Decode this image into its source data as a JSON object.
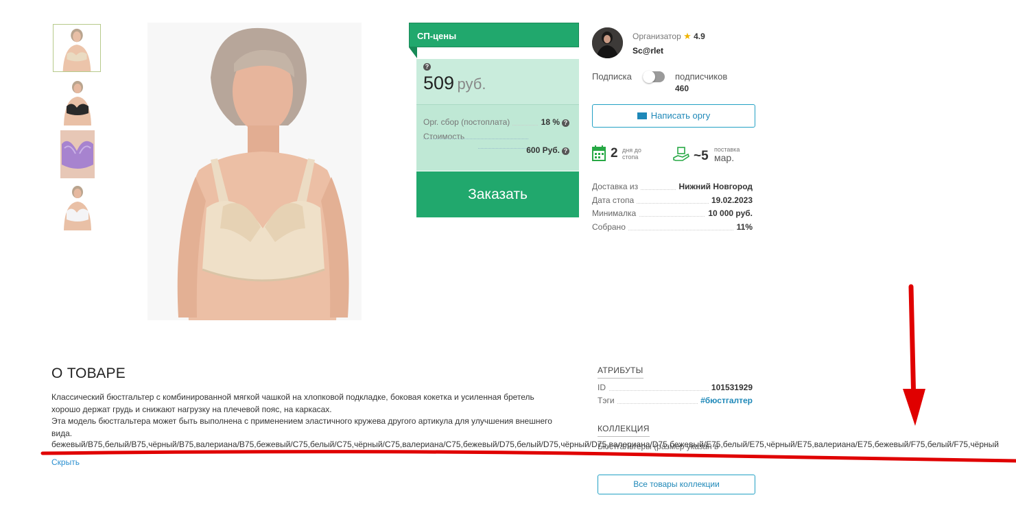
{
  "price_box": {
    "header": "СП-цены",
    "price_value": "509",
    "price_currency": "руб.",
    "fee_label": "Орг. сбор (постоплата)",
    "fee_value": "18 %",
    "cost_label": "Стоимость",
    "cost_value": "600 Руб.",
    "order_button": "Заказать"
  },
  "organizer": {
    "role_label": "Организатор",
    "rating": "4.9",
    "name": "Sc@rlet",
    "subscribe_label": "Подписка",
    "subscribers_label": "подписчиков",
    "subscribers_count": "460",
    "message_button": "Написать оргу"
  },
  "stats": {
    "days_value": "2",
    "days_label_1": "дня до",
    "days_label_2": "стопа",
    "delivery_value": "~5",
    "delivery_label_1": "поставка",
    "delivery_label_2": "мар."
  },
  "details": [
    {
      "label": "Доставка из",
      "value": "Нижний Новгород"
    },
    {
      "label": "Дата стопа",
      "value": "19.02.2023"
    },
    {
      "label": "Минималка",
      "value": "10 000 руб."
    },
    {
      "label": "Собрано",
      "value": "11%"
    }
  ],
  "about": {
    "title": "О ТОВАРЕ",
    "line1": "Классический бюстгальтер  с  комбинированной мягкой чашкой на  хлопковой подкладке, боковая кокетка и усиленная бретель",
    "line2": "хорошо держат грудь  и снижают нагрузку на плечевой пояс, на каркасах.",
    "line3": "Эта модель бюстгальтера может быть выполнена с применением эластичного кружева другого артикула для улучшения внешнего",
    "line4": "вида.",
    "variants": "бежевый/B75,белый/B75,чёрный/B75,валериана/B75,бежевый/C75,белый/C75,чёрный/C75,валериана/C75,бежевый/D75,белый/D75,чёрный/D75,валериана/D75,бежевый/E75,белый/E75,чёрный/E75,валериана/E75,бежевый/F75,белый/F75,чёрный",
    "hide_link": "Скрыть"
  },
  "attributes": {
    "title": "АТРИБУТЫ",
    "id_label": "ID",
    "id_value": "101531929",
    "tags_label": "Тэги",
    "tags_value": "#бюстгалтер"
  },
  "collection": {
    "title": "КОЛЛЕКЦИЯ",
    "overlap_text": "Бюстгальтеры (размер указан в",
    "all_button": "Все товары коллекции"
  },
  "colors": {
    "accent_green": "#21a86d",
    "price_bg": "#bfe8d5",
    "link_blue": "#1e88b8",
    "annotation_red": "#e00000"
  }
}
